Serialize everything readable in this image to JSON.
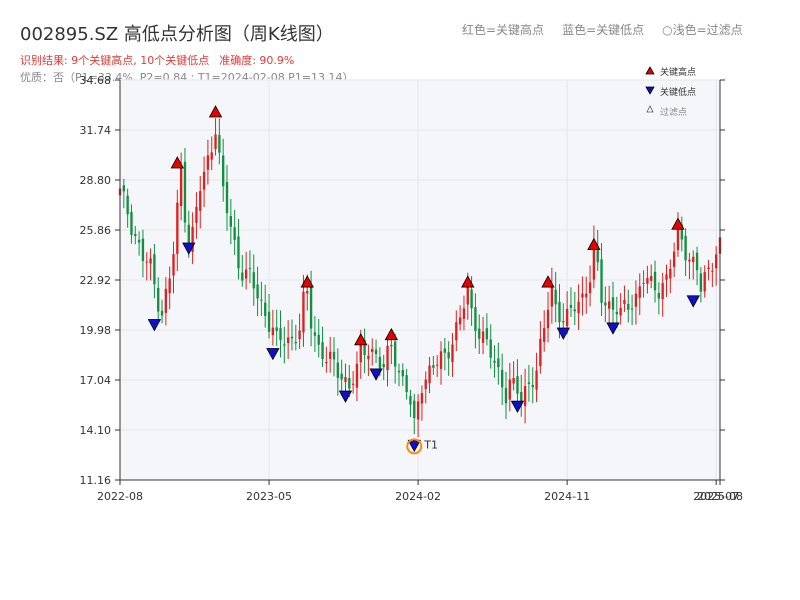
{
  "header": {
    "title": "002895.SZ 高低点分析图（周K线图）",
    "result_text": "识别结果: 9个关键高点, 10个关键低点",
    "accuracy_text": "准确度: 90.9%",
    "quality_text": "优质：否（P1=33.4%, P2=0.84 ; T1=2024-02-08 P1=13.14）",
    "legend_red": "红色=关键高点",
    "legend_blue": "蓝色=关键低点",
    "legend_light": "○浅色=过滤点"
  },
  "colors": {
    "up": "#e02020",
    "down": "#109040",
    "high_marker": "#e60000",
    "low_marker": "#1010cc",
    "t1_ring": "#ff8c00",
    "grid": "#e2e6ec",
    "plot_bg": "#f4f6f9"
  },
  "chart_data": {
    "type": "candlestick",
    "title": "002895.SZ 高低点分析图（周K线图）",
    "y_ticks": [
      "11.16",
      "14.10",
      "17.04",
      "19.98",
      "22.92",
      "25.86",
      "28.80",
      "31.74",
      "34.68"
    ],
    "ylim": [
      11.16,
      34.68
    ],
    "x_ticks": [
      "2022-08",
      "2023-05",
      "2024-02",
      "2024-11",
      "2025-07",
      "2025-08"
    ],
    "x_tick_positions": [
      0,
      39,
      78,
      117,
      156,
      157
    ],
    "x_range": [
      0,
      157
    ],
    "grid": true,
    "legend_position": "top-right",
    "legend": [
      {
        "label": "关键高点",
        "marker": "triangle-up",
        "color": "#e60000"
      },
      {
        "label": "关键低点",
        "marker": "triangle-down",
        "color": "#1010cc"
      },
      {
        "label": "过滤点",
        "marker": "triangle-up-hollow",
        "color": "#888888"
      }
    ],
    "close_series": [
      [
        0,
        28.0
      ],
      [
        2,
        27.0
      ],
      [
        4,
        25.5
      ],
      [
        6,
        24.2
      ],
      [
        8,
        23.6
      ],
      [
        10,
        21.8
      ],
      [
        11,
        21.0
      ],
      [
        13,
        23.0
      ],
      [
        14,
        24.5
      ],
      [
        15,
        27.0
      ],
      [
        16,
        29.5
      ],
      [
        17,
        27.0
      ],
      [
        18,
        25.0
      ],
      [
        19,
        25.6
      ],
      [
        20,
        27.0
      ],
      [
        21,
        28.3
      ],
      [
        22,
        29.0
      ],
      [
        23,
        30.0
      ],
      [
        24,
        31.0
      ],
      [
        25,
        32.0
      ],
      [
        26,
        30.0
      ],
      [
        27,
        28.0
      ],
      [
        28,
        27.0
      ],
      [
        29,
        26.0
      ],
      [
        30,
        25.0
      ],
      [
        31,
        24.0
      ],
      [
        32,
        23.5
      ],
      [
        34,
        23.0
      ],
      [
        36,
        22.0
      ],
      [
        38,
        21.0
      ],
      [
        40,
        20.0
      ],
      [
        41,
        19.2
      ],
      [
        43,
        19.4
      ],
      [
        45,
        19.5
      ],
      [
        47,
        20.0
      ],
      [
        48,
        21.5
      ],
      [
        49,
        22.0
      ],
      [
        50,
        20.5
      ],
      [
        52,
        19.0
      ],
      [
        54,
        18.3
      ],
      [
        56,
        17.8
      ],
      [
        58,
        17.4
      ],
      [
        60,
        16.7
      ],
      [
        62,
        17.5
      ],
      [
        63,
        18.7
      ],
      [
        65,
        19.0
      ],
      [
        67,
        18.5
      ],
      [
        69,
        17.5
      ],
      [
        71,
        19.3
      ],
      [
        72,
        18.5
      ],
      [
        73,
        17.5
      ],
      [
        75,
        16.5
      ],
      [
        76,
        15.5
      ],
      [
        77,
        14.2
      ],
      [
        78,
        15.8
      ],
      [
        79,
        17.0
      ],
      [
        81,
        17.5
      ],
      [
        83,
        18.0
      ],
      [
        85,
        18.5
      ],
      [
        87,
        19.5
      ],
      [
        89,
        20.5
      ],
      [
        91,
        22.3
      ],
      [
        92,
        21.0
      ],
      [
        94,
        20.0
      ],
      [
        96,
        19.0
      ],
      [
        98,
        18.0
      ],
      [
        100,
        17.0
      ],
      [
        101,
        16.3
      ],
      [
        102,
        16.8
      ],
      [
        104,
        16.3
      ],
      [
        105,
        15.9
      ],
      [
        107,
        17.0
      ],
      [
        109,
        17.5
      ],
      [
        111,
        20.0
      ],
      [
        112,
        21.5
      ],
      [
        113,
        22.5
      ],
      [
        114,
        21.5
      ],
      [
        116,
        20.5
      ],
      [
        117,
        20.5
      ],
      [
        119,
        21.5
      ],
      [
        121,
        22.0
      ],
      [
        123,
        23.0
      ],
      [
        124,
        24.5
      ],
      [
        125,
        23.5
      ],
      [
        126,
        22.0
      ],
      [
        128,
        21.5
      ],
      [
        130,
        21.2
      ],
      [
        131,
        20.8
      ],
      [
        133,
        21.5
      ],
      [
        135,
        22.0
      ],
      [
        137,
        23.0
      ],
      [
        139,
        22.5
      ],
      [
        141,
        22.5
      ],
      [
        143,
        23.0
      ],
      [
        145,
        24.5
      ],
      [
        146,
        25.8
      ],
      [
        147,
        25.3
      ],
      [
        149,
        24.3
      ],
      [
        151,
        23.5
      ],
      [
        152,
        22.3
      ],
      [
        154,
        23.5
      ],
      [
        156,
        24.8
      ],
      [
        157,
        25.0
      ]
    ],
    "highs": [
      {
        "x": 15,
        "y": 29.8
      },
      {
        "x": 25,
        "y": 32.8
      },
      {
        "x": 49,
        "y": 22.8
      },
      {
        "x": 63,
        "y": 19.4
      },
      {
        "x": 71,
        "y": 19.7
      },
      {
        "x": 91,
        "y": 22.8
      },
      {
        "x": 112,
        "y": 22.8
      },
      {
        "x": 124,
        "y": 25.0
      },
      {
        "x": 146,
        "y": 26.2
      }
    ],
    "lows": [
      {
        "x": 9,
        "y": 20.3
      },
      {
        "x": 18,
        "y": 24.8
      },
      {
        "x": 40,
        "y": 18.6
      },
      {
        "x": 59,
        "y": 16.1
      },
      {
        "x": 67,
        "y": 17.4
      },
      {
        "x": 77,
        "y": 13.2
      },
      {
        "x": 104,
        "y": 15.5
      },
      {
        "x": 116,
        "y": 19.8
      },
      {
        "x": 129,
        "y": 20.1
      },
      {
        "x": 150,
        "y": 21.7
      }
    ],
    "annotation": {
      "text": "T1",
      "x": 77,
      "y": 13.14
    }
  }
}
